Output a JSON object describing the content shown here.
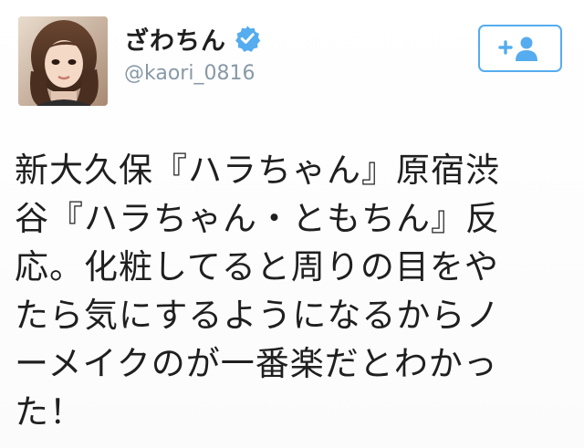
{
  "user": {
    "display_name": "ざわちん",
    "handle": "@kaori_0816",
    "verified": true,
    "avatar": "profile-photo"
  },
  "follow_button": {
    "icon": "add-user-icon",
    "accent_color": "#55acee"
  },
  "tweet": {
    "lines": [
      "新大久保『ハラちゃん』原宿渋",
      "谷『ハラちゃん・ともちん』反",
      "応。化粧してると周りの目をや",
      "たら気にするようになるからノ",
      "ーメイクのが一番楽だとわかっ",
      "た！"
    ]
  },
  "colors": {
    "text": "#1f1f1f",
    "handle": "#8899a6",
    "verified_badge": "#55acee"
  }
}
